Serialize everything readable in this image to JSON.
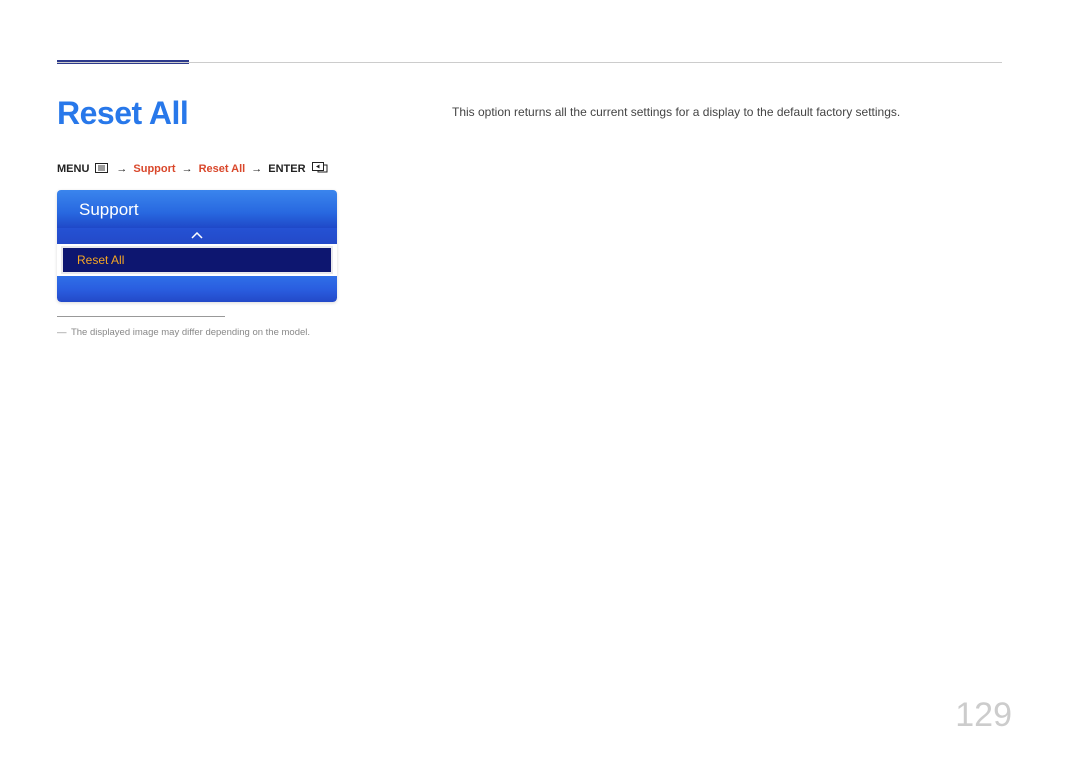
{
  "title": "Reset All",
  "breadcrumb": {
    "menu_label": "MENU",
    "arrow": "→",
    "support": "Support",
    "reset_all": "Reset All",
    "enter_label": "ENTER"
  },
  "osd": {
    "header": "Support",
    "item": "Reset All"
  },
  "footnote": "The displayed image may differ depending on the model.",
  "description": "This option returns all the current settings for a display to the default factory settings.",
  "page_number": "129"
}
